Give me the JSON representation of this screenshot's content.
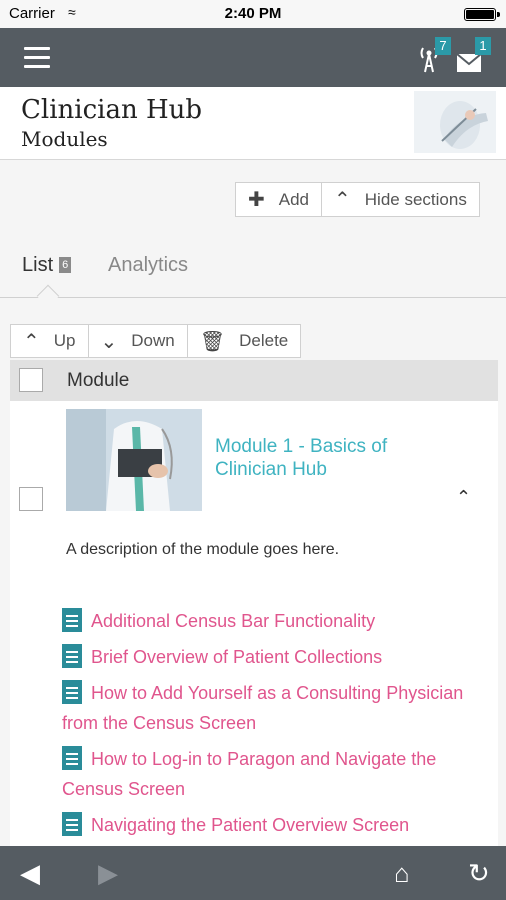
{
  "status": {
    "carrier": "Carrier",
    "time": "2:40 PM"
  },
  "topbar": {
    "antenna_badge": "7",
    "mail_badge": "1"
  },
  "header": {
    "title": "Clinician Hub",
    "subtitle": "Modules"
  },
  "actions": {
    "add": "Add",
    "hide": "Hide sections"
  },
  "tabs": {
    "list": "List",
    "list_count": "6",
    "analytics": "Analytics"
  },
  "toolbar": {
    "up": "Up",
    "down": "Down",
    "delete": "Delete"
  },
  "table": {
    "column": "Module"
  },
  "module": {
    "title": "Module 1 - Basics of Clinician Hub",
    "description": "A description of the module goes here.",
    "links": [
      "Additional Census Bar Functionality",
      "Brief Overview of Patient Collections",
      "How to Add Yourself as a Consulting Physician from the Census Screen",
      "How to Log-in to Paragon and Navigate the Census Screen",
      "Navigating the Patient Overview Screen"
    ]
  },
  "colors": {
    "bar": "#555c62",
    "accent": "#3fb3c1",
    "link": "#e0558d",
    "badge": "#2b9aa8"
  },
  "icons": [
    "hamburger-icon",
    "antenna-icon",
    "mail-icon",
    "plus-icon",
    "chevron-up-icon",
    "chevron-down-icon",
    "trash-icon",
    "document-icon",
    "back-icon",
    "forward-icon",
    "home-icon",
    "refresh-icon"
  ]
}
